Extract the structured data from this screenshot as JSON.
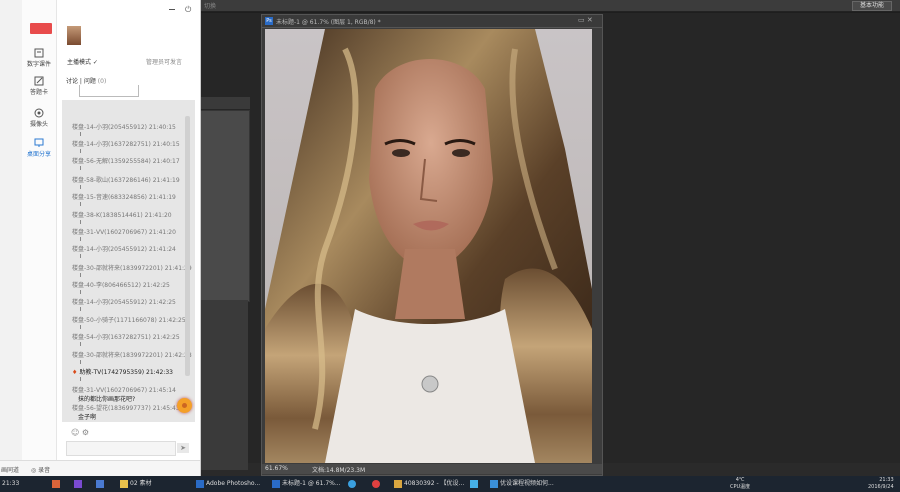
{
  "photoshop": {
    "menu_label": "切换",
    "workspace_button": "基本功能",
    "document_tab": "未标题-1 @ 61.7% (图层 1, RGB/8) *",
    "status_zoom": "61.67%",
    "status_doc": "文档:14.8M/23.3M"
  },
  "chat": {
    "nav": [
      {
        "label": "数字课件"
      },
      {
        "label": "答题卡"
      },
      {
        "label": "摄像头"
      },
      {
        "label": "桌面分享"
      }
    ],
    "host_label": "主播模式 ✓",
    "manage_link": "管理员可发言",
    "discuss_label": "讨论",
    "discuss_tab": "问题",
    "discuss_count": "(0)",
    "messages": [
      {
        "text": "楼盘-14-小羽(205455912) 21:40:15"
      },
      {
        "text": "楼盘-14-小羽(1637282751) 21:40:15"
      },
      {
        "text": "楼盘-56-无解(1359255584) 21:40:17"
      },
      {
        "text": "楼盘-58-歌山(1637286146) 21:41:19"
      },
      {
        "text": "楼盘-15-音速(683324856) 21:41:19"
      },
      {
        "text": "楼盘-38-K(1838514461) 21:41:20"
      },
      {
        "text": "楼盘-31-VV(1602706967) 21:41:20"
      },
      {
        "text": "楼盘-14-小羽(205455912) 21:41:24"
      },
      {
        "text": "楼盘-30-邵就将来(1839972201) 21:41:29"
      },
      {
        "text": "楼盘-40-李(806466512) 21:42:25"
      },
      {
        "text": "楼盘-14-小羽(205455912) 21:42:25"
      },
      {
        "text": "楼盘-50-小骑子(1171166078) 21:42:25"
      },
      {
        "text": "楼盘-54-小羽(1637282751) 21:42:25"
      },
      {
        "text": "楼盘-30-邵就将来(1839972201) 21:42:28"
      },
      {
        "text": "助教-TV(1742795359) 21:42:33"
      },
      {
        "text": "楼盘-31-VV(1602706967) 21:45:14"
      },
      {
        "text": "抹的都比你画那花吧?"
      },
      {
        "text": "楼盘-56-望花(1836997737) 21:45:43"
      },
      {
        "text": "金子啊"
      }
    ],
    "recording_label": "录音",
    "bottom_left_label": "画同道"
  },
  "taskbar": {
    "items": [
      {
        "label": "02 素材",
        "color": "#e8c14c"
      },
      {
        "label": "Adobe Photosho...",
        "color": "#2a6bc6"
      },
      {
        "label": "未标题-1 @ 61.7%...",
        "color": "#2a6bc6"
      },
      {
        "label": "40830392 - 【优设...",
        "color": "#d9a640"
      },
      {
        "label": "优设课程视频如何...",
        "color": "#3a8fd8"
      }
    ],
    "clock_time": "21:33",
    "temp": "4℃",
    "cpu": "CPU温度",
    "date": "2016/9/24"
  }
}
